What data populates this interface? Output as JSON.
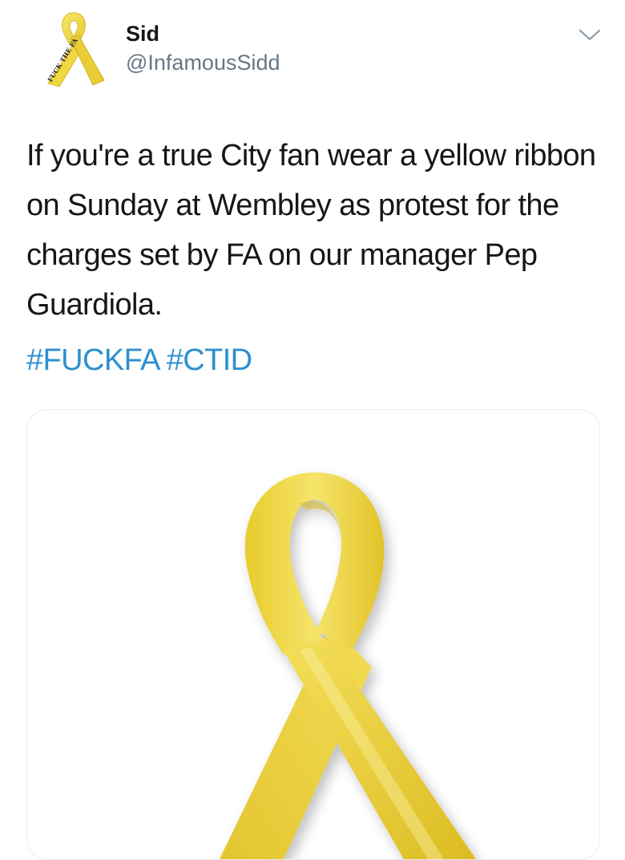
{
  "user": {
    "display_name": "Sid",
    "handle": "@InfamousSidd",
    "avatar": {
      "icon": "yellow-ribbon-icon",
      "ribbon_text": "FUCK THE FA"
    }
  },
  "tweet": {
    "text": "If you're a true City fan wear a yellow ribbon on Sunday at Wembley as protest for the charges set by FA on our manager Pep Guardiola.",
    "hashtags": [
      "#FUCKFA",
      "#CTID"
    ]
  },
  "media": {
    "icon": "yellow-ribbon-image"
  },
  "colors": {
    "hashtag": "#2d8fd0",
    "handle": "#657786",
    "ribbon": "#f1dc4a"
  }
}
